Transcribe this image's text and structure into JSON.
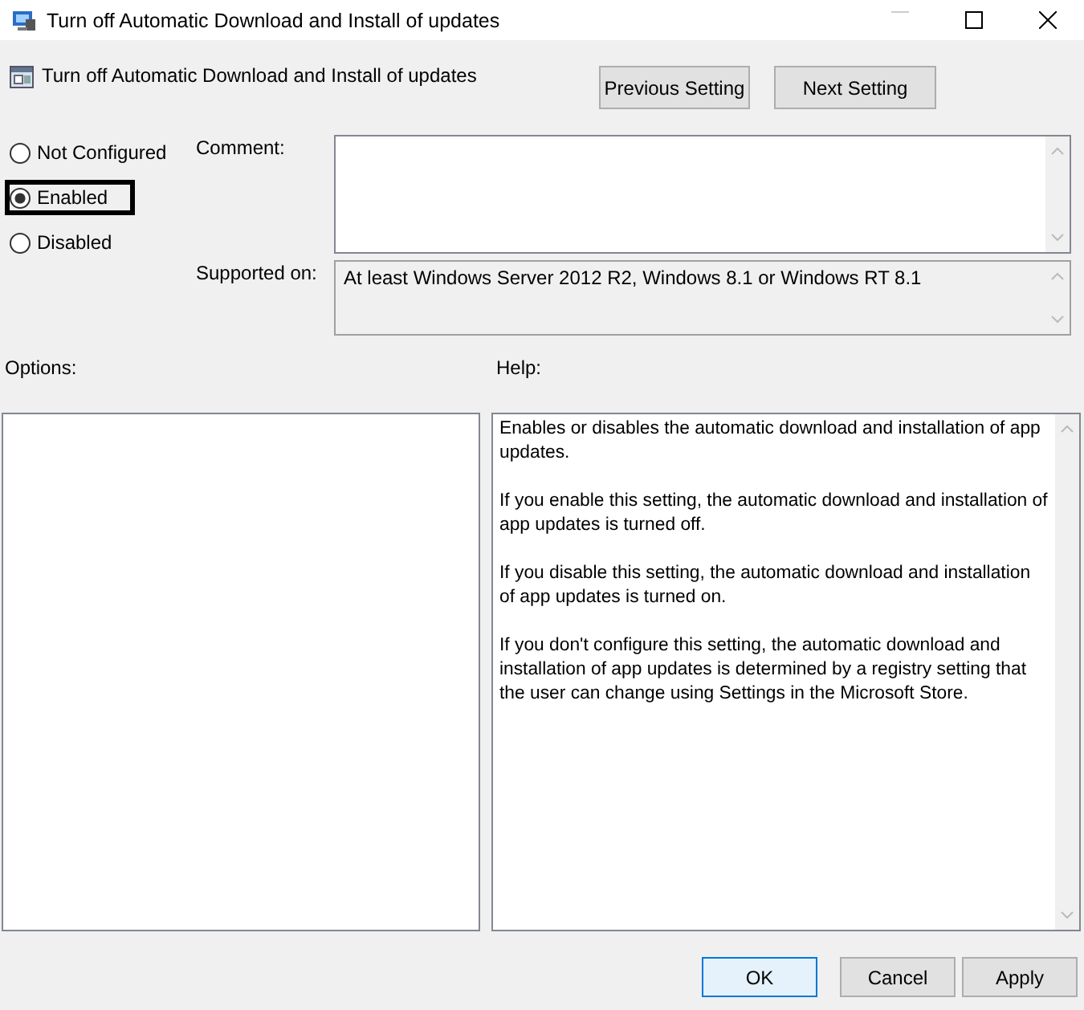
{
  "window": {
    "title": "Turn off Automatic Download and Install of updates"
  },
  "setting": {
    "title": "Turn off Automatic Download and Install of updates"
  },
  "nav_buttons": [
    "Previous Setting",
    "Next Setting"
  ],
  "states": [
    {
      "label": "Not Configured",
      "selected": false,
      "focused": false
    },
    {
      "label": "Enabled",
      "selected": true,
      "focused": true
    },
    {
      "label": "Disabled",
      "selected": false,
      "focused": false
    }
  ],
  "comment": {
    "label": "Comment:"
  },
  "supported_on": {
    "label": "Supported on:",
    "value": "At least Windows Server 2012 R2, Windows 8.1 or Windows RT 8.1"
  },
  "options": {
    "label": "Options:"
  },
  "help": {
    "label": "Help:",
    "paragraphs": [
      "Enables or disables the automatic download and installation of app updates.",
      "If you enable this setting, the automatic download and installation of app updates is turned off.",
      "If you disable this setting, the automatic download and installation of app updates is turned on.",
      "If you don't configure this setting, the automatic download and installation of app updates is determined by a registry setting that the user can change using Settings in the Microsoft Store."
    ]
  },
  "buttons": [
    {
      "label": "OK",
      "default": true
    },
    {
      "label": "Cancel",
      "default": false
    },
    {
      "label": "Apply",
      "default": false
    }
  ]
}
